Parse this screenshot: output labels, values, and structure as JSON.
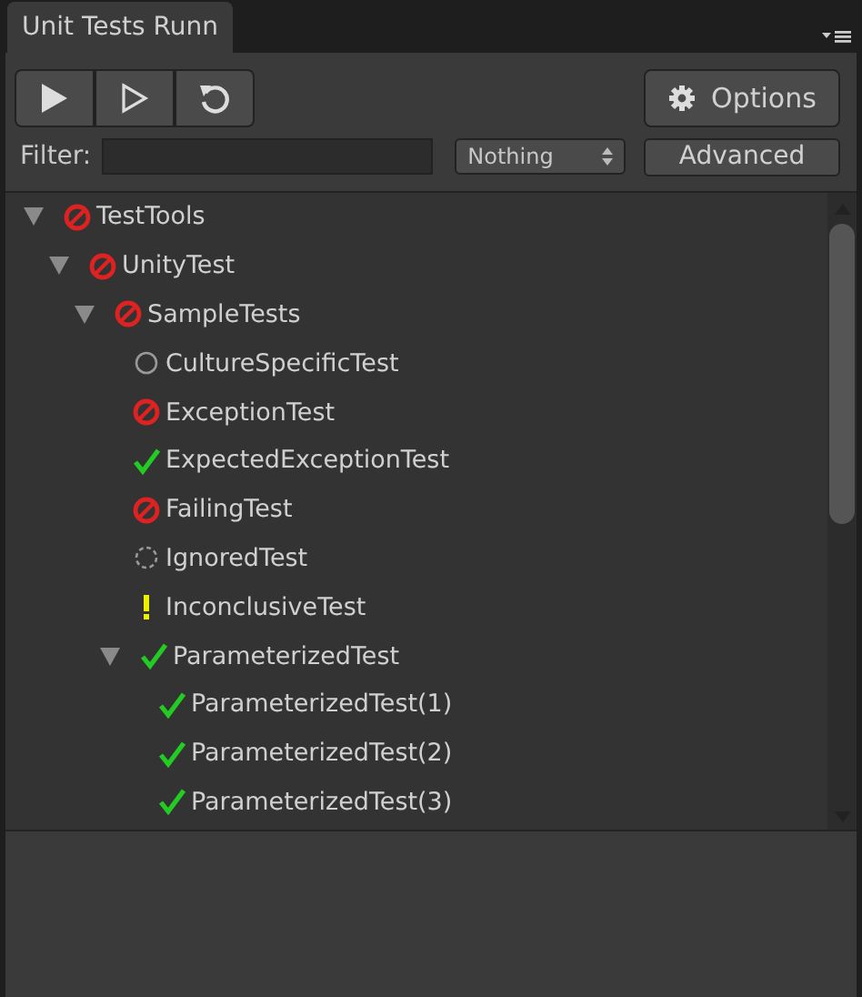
{
  "tab": {
    "title": "Unit Tests Runn",
    "selected": true
  },
  "toolbar": {
    "options_label": "Options"
  },
  "filter": {
    "label": "Filter:",
    "dropdown": "Nothing",
    "advanced_label": "Advanced"
  },
  "tree": [
    {
      "label": "TestTools",
      "kind": "failed",
      "expanded": true,
      "children": [
        {
          "label": "UnityTest",
          "kind": "failed",
          "expanded": true,
          "children": [
            {
              "label": "SampleTests",
              "kind": "failed",
              "expanded": true,
              "children": [
                {
                  "label": "CultureSpecificTest",
                  "kind": "notrun"
                },
                {
                  "label": "ExceptionTest",
                  "kind": "failed"
                },
                {
                  "label": "ExpectedExceptionTest",
                  "kind": "passed"
                },
                {
                  "label": "FailingTest",
                  "kind": "failed"
                },
                {
                  "label": "IgnoredTest",
                  "kind": "ignored"
                },
                {
                  "label": "InconclusiveTest",
                  "kind": "inconclusive"
                },
                {
                  "label": "ParameterizedTest",
                  "kind": "passed",
                  "expanded": true,
                  "children": [
                    {
                      "label": "ParameterizedTest(1)",
                      "kind": "passed"
                    },
                    {
                      "label": "ParameterizedTest(2)",
                      "kind": "passed"
                    },
                    {
                      "label": "ParameterizedTest(3)",
                      "kind": "passed"
                    }
                  ]
                }
              ]
            }
          ]
        }
      ]
    }
  ]
}
